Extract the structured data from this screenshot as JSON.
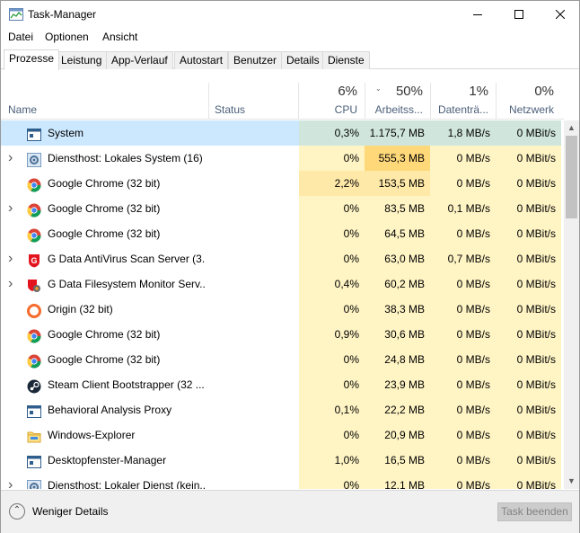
{
  "window": {
    "title": "Task-Manager"
  },
  "menu": [
    "Datei",
    "Optionen",
    "Ansicht"
  ],
  "tabs": [
    "Prozesse",
    "Leistung",
    "App-Verlauf",
    "Autostart",
    "Benutzer",
    "Details",
    "Dienste"
  ],
  "columns": {
    "name": {
      "label": "Name"
    },
    "status": {
      "label": "Status"
    },
    "cpu": {
      "pct": "6%",
      "label": "CPU"
    },
    "mem": {
      "pct": "50%",
      "label": "Arbeitss..."
    },
    "disk": {
      "pct": "1%",
      "label": "Datenträ..."
    },
    "net": {
      "pct": "0%",
      "label": "Netzwerk"
    }
  },
  "colors": {
    "heat_low": "#fff4c4",
    "heat_mid": "#ffe9a8",
    "heat_high": "#ffd87a",
    "selection": "#cce8ff"
  },
  "processes": [
    {
      "name": "System",
      "expandable": false,
      "icon": "window-icon",
      "cpu": "0,3%",
      "mem": "1.175,7 MB",
      "disk": "1,8 MB/s",
      "net": "0 MBit/s",
      "selected": true
    },
    {
      "name": "Diensthost: Lokales System (16)",
      "expandable": true,
      "icon": "gear-icon",
      "cpu": "0%",
      "mem": "555,3 MB",
      "disk": "0 MB/s",
      "net": "0 MBit/s"
    },
    {
      "name": "Google Chrome (32 bit)",
      "expandable": false,
      "icon": "chrome-icon",
      "cpu": "2,2%",
      "mem": "153,5 MB",
      "disk": "0 MB/s",
      "net": "0 MBit/s"
    },
    {
      "name": "Google Chrome (32 bit)",
      "expandable": true,
      "icon": "chrome-icon",
      "cpu": "0%",
      "mem": "83,5 MB",
      "disk": "0,1 MB/s",
      "net": "0 MBit/s"
    },
    {
      "name": "Google Chrome (32 bit)",
      "expandable": false,
      "icon": "chrome-icon",
      "cpu": "0%",
      "mem": "64,5 MB",
      "disk": "0 MB/s",
      "net": "0 MBit/s"
    },
    {
      "name": "G Data AntiVirus Scan Server (3...",
      "expandable": true,
      "icon": "gdata-icon",
      "cpu": "0%",
      "mem": "63,0 MB",
      "disk": "0,7 MB/s",
      "net": "0 MBit/s"
    },
    {
      "name": "G Data Filesystem Monitor Serv...",
      "expandable": true,
      "icon": "gdata-shield-icon",
      "cpu": "0,4%",
      "mem": "60,2 MB",
      "disk": "0 MB/s",
      "net": "0 MBit/s"
    },
    {
      "name": "Origin (32 bit)",
      "expandable": false,
      "icon": "origin-icon",
      "cpu": "0%",
      "mem": "38,3 MB",
      "disk": "0 MB/s",
      "net": "0 MBit/s"
    },
    {
      "name": "Google Chrome (32 bit)",
      "expandable": false,
      "icon": "chrome-icon",
      "cpu": "0,9%",
      "mem": "30,6 MB",
      "disk": "0 MB/s",
      "net": "0 MBit/s"
    },
    {
      "name": "Google Chrome (32 bit)",
      "expandable": false,
      "icon": "chrome-icon",
      "cpu": "0%",
      "mem": "24,8 MB",
      "disk": "0 MB/s",
      "net": "0 MBit/s"
    },
    {
      "name": "Steam Client Bootstrapper (32 ...",
      "expandable": false,
      "icon": "steam-icon",
      "cpu": "0%",
      "mem": "23,9 MB",
      "disk": "0 MB/s",
      "net": "0 MBit/s"
    },
    {
      "name": "Behavioral Analysis Proxy",
      "expandable": false,
      "icon": "window-icon",
      "cpu": "0,1%",
      "mem": "22,2 MB",
      "disk": "0 MB/s",
      "net": "0 MBit/s"
    },
    {
      "name": "Windows-Explorer",
      "expandable": false,
      "icon": "folder-icon",
      "cpu": "0%",
      "mem": "20,9 MB",
      "disk": "0 MB/s",
      "net": "0 MBit/s"
    },
    {
      "name": "Desktopfenster-Manager",
      "expandable": false,
      "icon": "window-icon",
      "cpu": "1,0%",
      "mem": "16,5 MB",
      "disk": "0 MB/s",
      "net": "0 MBit/s"
    },
    {
      "name": "Diensthost: Lokaler Dienst (kein...",
      "expandable": true,
      "icon": "gear-icon",
      "cpu": "0%",
      "mem": "12,1 MB",
      "disk": "0 MB/s",
      "net": "0 MBit/s"
    }
  ],
  "footer": {
    "less_details": "Weniger Details",
    "end_task": "Task beenden"
  }
}
